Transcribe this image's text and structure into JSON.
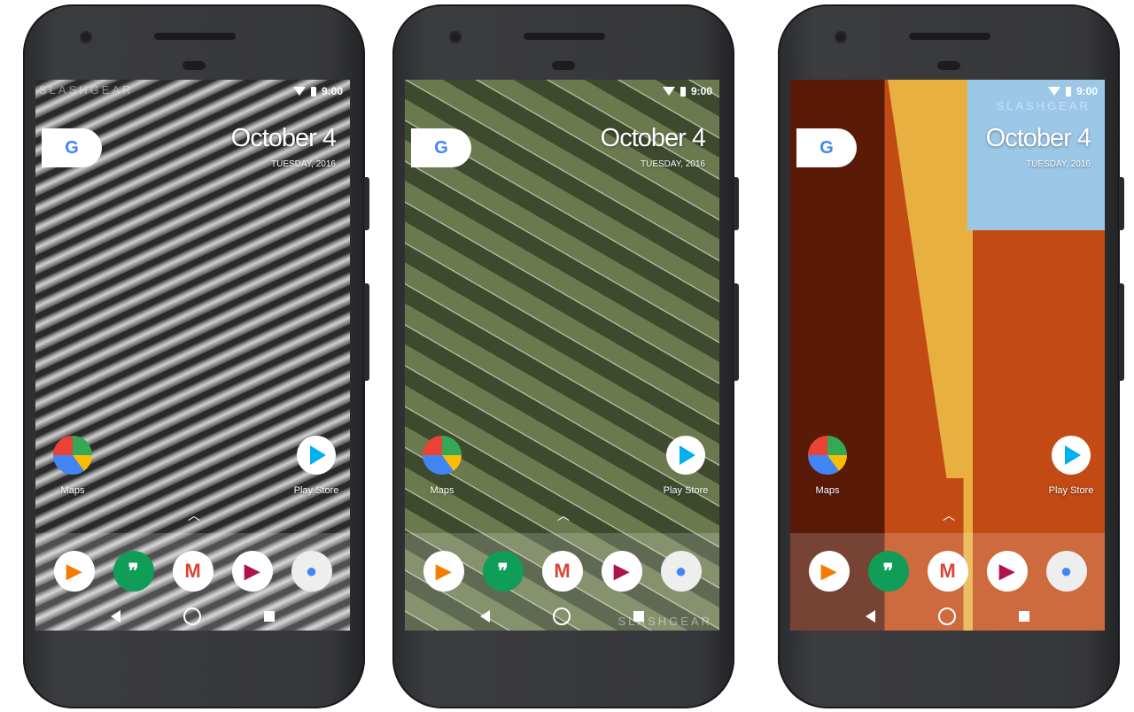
{
  "phones": [
    {
      "wallpaper": "monochrome-sand-dunes",
      "colors": [
        "#2a2a2a",
        "#9a9a9a",
        "#d0d0d0",
        "#555555"
      ]
    },
    {
      "wallpaper": "aerial-farm-fields",
      "colors": [
        "#3d4a2e",
        "#6b7a4e",
        "#2f3f22",
        "#8a8f6a"
      ]
    },
    {
      "wallpaper": "orange-walls-sky",
      "colors": [
        "#5a1a08",
        "#c24a14",
        "#e8b040",
        "#9cc8e8"
      ]
    }
  ],
  "status_bar": {
    "time": "9:00",
    "icons": [
      "wifi-icon",
      "battery-icon"
    ]
  },
  "watermark": "SLASHGEAR",
  "google_pill": {
    "icon": "google-icon",
    "letter": "G"
  },
  "date_widget": {
    "date": "October 4",
    "day_year": "TUESDAY, 2016"
  },
  "home_apps": [
    {
      "label": "Maps",
      "icon": "maps-icon"
    },
    {
      "label": "Play Store",
      "icon": "play-store-icon"
    }
  ],
  "dock_apps": [
    {
      "name": "Play Music",
      "icon": "play-music-icon",
      "glyph": "▶",
      "color": "#f57c00"
    },
    {
      "name": "Hangouts",
      "icon": "hangouts-icon",
      "glyph": "❞",
      "color": "#0f9d58"
    },
    {
      "name": "Gmail",
      "icon": "gmail-icon",
      "glyph": "M",
      "color": "#db4437"
    },
    {
      "name": "Play Movies",
      "icon": "play-movies-icon",
      "glyph": "▶",
      "color": "#b0124e"
    },
    {
      "name": "Camera",
      "icon": "camera-icon",
      "glyph": "●",
      "color": "#4285f4"
    }
  ],
  "nav_bar": [
    "back-button",
    "home-button",
    "recents-button"
  ]
}
